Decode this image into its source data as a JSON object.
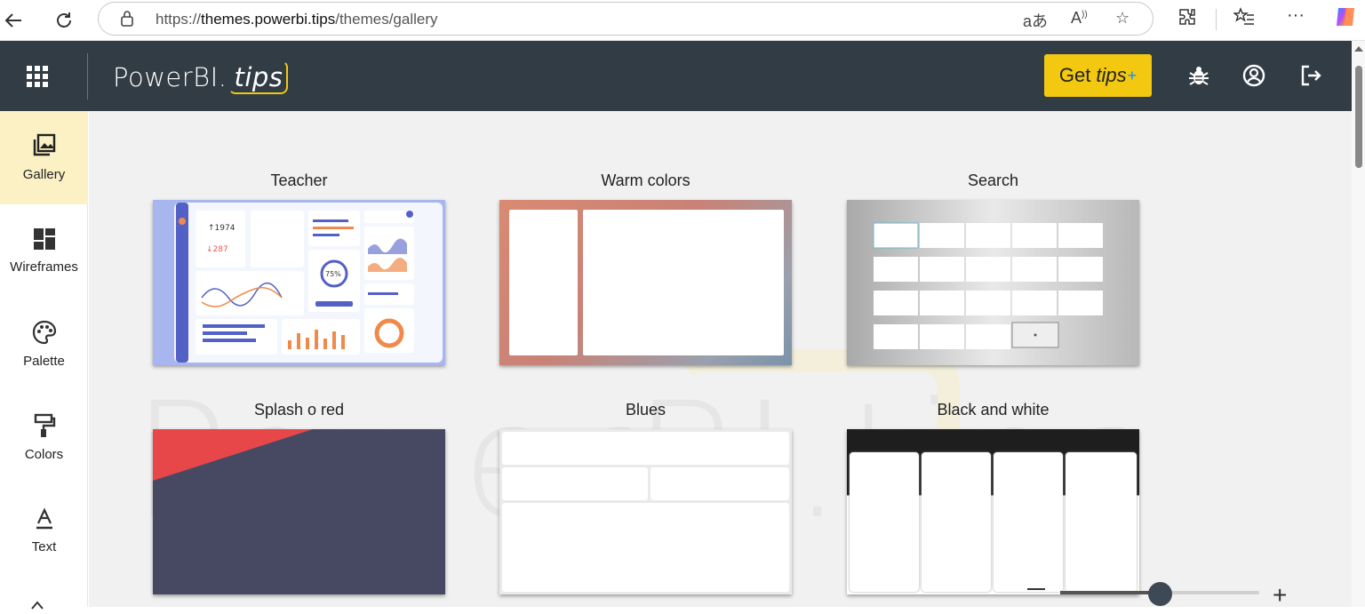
{
  "browser": {
    "url_prefix": "https://",
    "url_host": "themes.powerbi.tips",
    "url_path": "/themes/gallery",
    "back_icon": "back-arrow-icon",
    "refresh_icon": "refresh-icon",
    "translate_label": "aあ",
    "read_aloud_label": "Á"
  },
  "header": {
    "logo_main": "PowerBI.",
    "logo_tips": "tips",
    "get_tips_prefix": "Get",
    "get_tips_em": "tips",
    "get_tips_plus": "+"
  },
  "sidebar": {
    "items": [
      {
        "label": "Gallery",
        "icon": "gallery-icon",
        "active": true
      },
      {
        "label": "Wireframes",
        "icon": "wireframes-icon"
      },
      {
        "label": "Palette",
        "icon": "palette-icon"
      },
      {
        "label": "Colors",
        "icon": "paint-roller-icon"
      },
      {
        "label": "Text",
        "icon": "text-format-icon"
      }
    ]
  },
  "gallery": {
    "themes": [
      {
        "title": "Teacher"
      },
      {
        "title": "Warm colors"
      },
      {
        "title": "Search"
      },
      {
        "title": "Splash o red"
      },
      {
        "title": "Blues"
      },
      {
        "title": "Black and white"
      }
    ]
  },
  "watermark": {
    "text": "PowerBI.tips"
  },
  "colors": {
    "header_bg": "#313c45",
    "accent_yellow": "#f2c811",
    "sidebar_active_bg": "#fbf1c4",
    "main_bg": "#f1f1f1"
  }
}
